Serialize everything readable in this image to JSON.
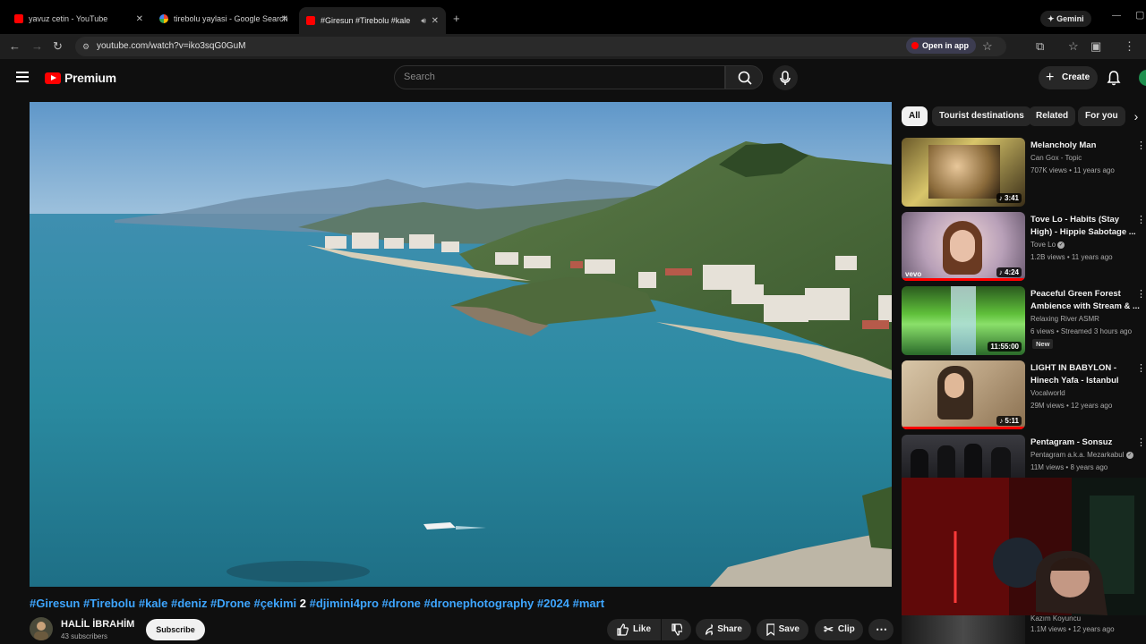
{
  "browser": {
    "tabs": [
      {
        "title": "yavuz cetin - YouTube"
      },
      {
        "title": "tirebolu yaylasi - Google Search"
      },
      {
        "title": "#Giresun #Tirebolu #kale #..."
      }
    ],
    "gemini_label": "Gemini",
    "url": "youtube.com/watch?v=iko3sqG0GuM",
    "open_in_app": "Open in app"
  },
  "header": {
    "logo_text": "Premium",
    "search_placeholder": "Search",
    "create_label": "Create"
  },
  "video": {
    "title_parts": [
      {
        "text": "#Giresun #Tirebolu #kale #deniz #Drone #çekimi ",
        "link": true
      },
      {
        "text": "2",
        "link": false
      },
      {
        "text": " #djimini4pro #drone #dronephotography #2024 #mart",
        "link": true
      }
    ],
    "channel_name": "HALİL İBRAHİM",
    "subscribers": "43 subscribers",
    "subscribe_label": "Subscribe",
    "actions": {
      "like": "Like",
      "share": "Share",
      "save": "Save",
      "clip": "Clip"
    }
  },
  "sidebar": {
    "chips": [
      "All",
      "Tourist destinations",
      "Related",
      "For you"
    ],
    "selected_chip": "All",
    "recommendations": [
      {
        "title": "Melancholy Man",
        "channel": "Can Gox - Topic",
        "stats": "707K views • 11 years ago",
        "duration": "♪ 3:41"
      },
      {
        "title": "Tove Lo - Habits (Stay High) - Hippie Sabotage ...",
        "channel": "Tove Lo",
        "stats": "1.2B views • 11 years ago",
        "duration": "♪ 4:24"
      },
      {
        "title": "Peaceful Green Forest Ambience with Stream & ...",
        "channel": "Relaxing River ASMR",
        "stats": "6 views • Streamed 3 hours ago",
        "duration": "11:55:00",
        "badge": "New"
      },
      {
        "title": "LIGHT IN BABYLON - Hinech Yafa    -   Istanbul",
        "channel": "Vocalworld",
        "stats": "29M views • 12 years ago",
        "duration": "♪ 5:11"
      },
      {
        "title": "Pentagram - Sonsuz",
        "channel": "Pentagram a.k.a. Mezarkabul",
        "stats": "11M views • 8 years ago"
      },
      {
        "channel": "Kazım Koyuncu",
        "stats": "1.1M views • 12 years ago"
      }
    ]
  },
  "colors": {
    "accent_red": "#ff0000",
    "link_blue": "#3ea6ff",
    "background": "#0f0f0f"
  }
}
